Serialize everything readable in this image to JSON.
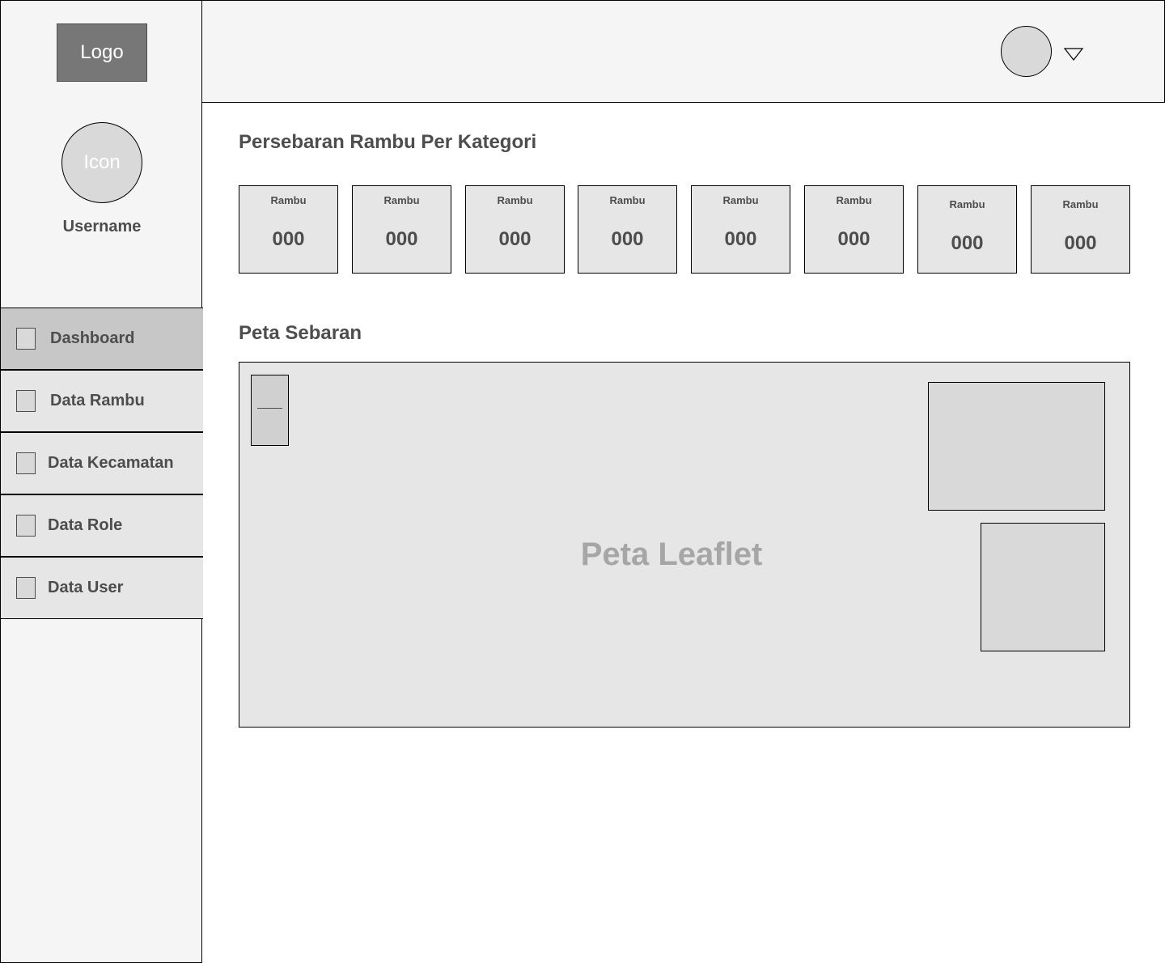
{
  "sidebar": {
    "logo_text": "Logo",
    "avatar_text": "Icon",
    "username": "Username",
    "nav": [
      {
        "label": "Dashboard",
        "active": true
      },
      {
        "label": "Data Rambu",
        "active": false
      },
      {
        "label": "Data Kecamatan",
        "active": false
      },
      {
        "label": "Data Role",
        "active": false
      },
      {
        "label": "Data User",
        "active": false
      }
    ]
  },
  "main": {
    "category_title": "Persebaran Rambu Per Kategori",
    "cards": [
      {
        "label": "Rambu",
        "value": "000"
      },
      {
        "label": "Rambu",
        "value": "000"
      },
      {
        "label": "Rambu",
        "value": "000"
      },
      {
        "label": "Rambu",
        "value": "000"
      },
      {
        "label": "Rambu",
        "value": "000"
      },
      {
        "label": "Rambu",
        "value": "000"
      },
      {
        "label": "Rambu",
        "value": "000"
      },
      {
        "label": "Rambu",
        "value": "000"
      }
    ],
    "map_title": "Peta Sebaran",
    "map_placeholder": "Peta Leaflet"
  },
  "icons": {
    "dropdown": "chevron-down-icon",
    "user": "user-avatar-icon"
  }
}
